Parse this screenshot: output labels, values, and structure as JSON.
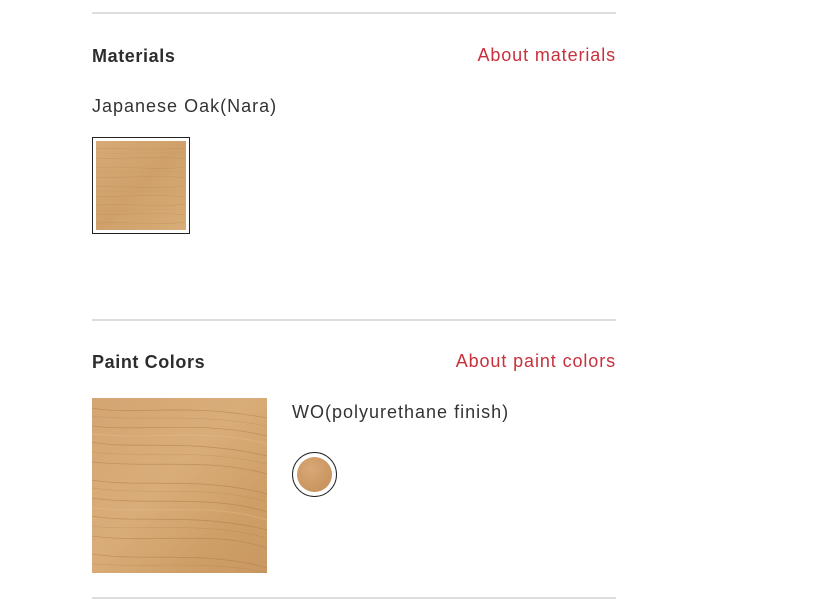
{
  "colors": {
    "accent": "#c8303b",
    "wood_base": "#d3a56e",
    "wood_grain": "#b7864f"
  },
  "materials": {
    "title": "Materials",
    "about_link": "About materials",
    "selected_name": "Japanese Oak(Nara)",
    "swatch_icon": "japanese-oak-swatch"
  },
  "paint_colors": {
    "title": "Paint Colors",
    "about_link": "About paint colors",
    "selected_name": "WO(polyurethane finish)",
    "preview_icon": "wo-finish-preview",
    "chip_icon": "wo-color-chip"
  }
}
